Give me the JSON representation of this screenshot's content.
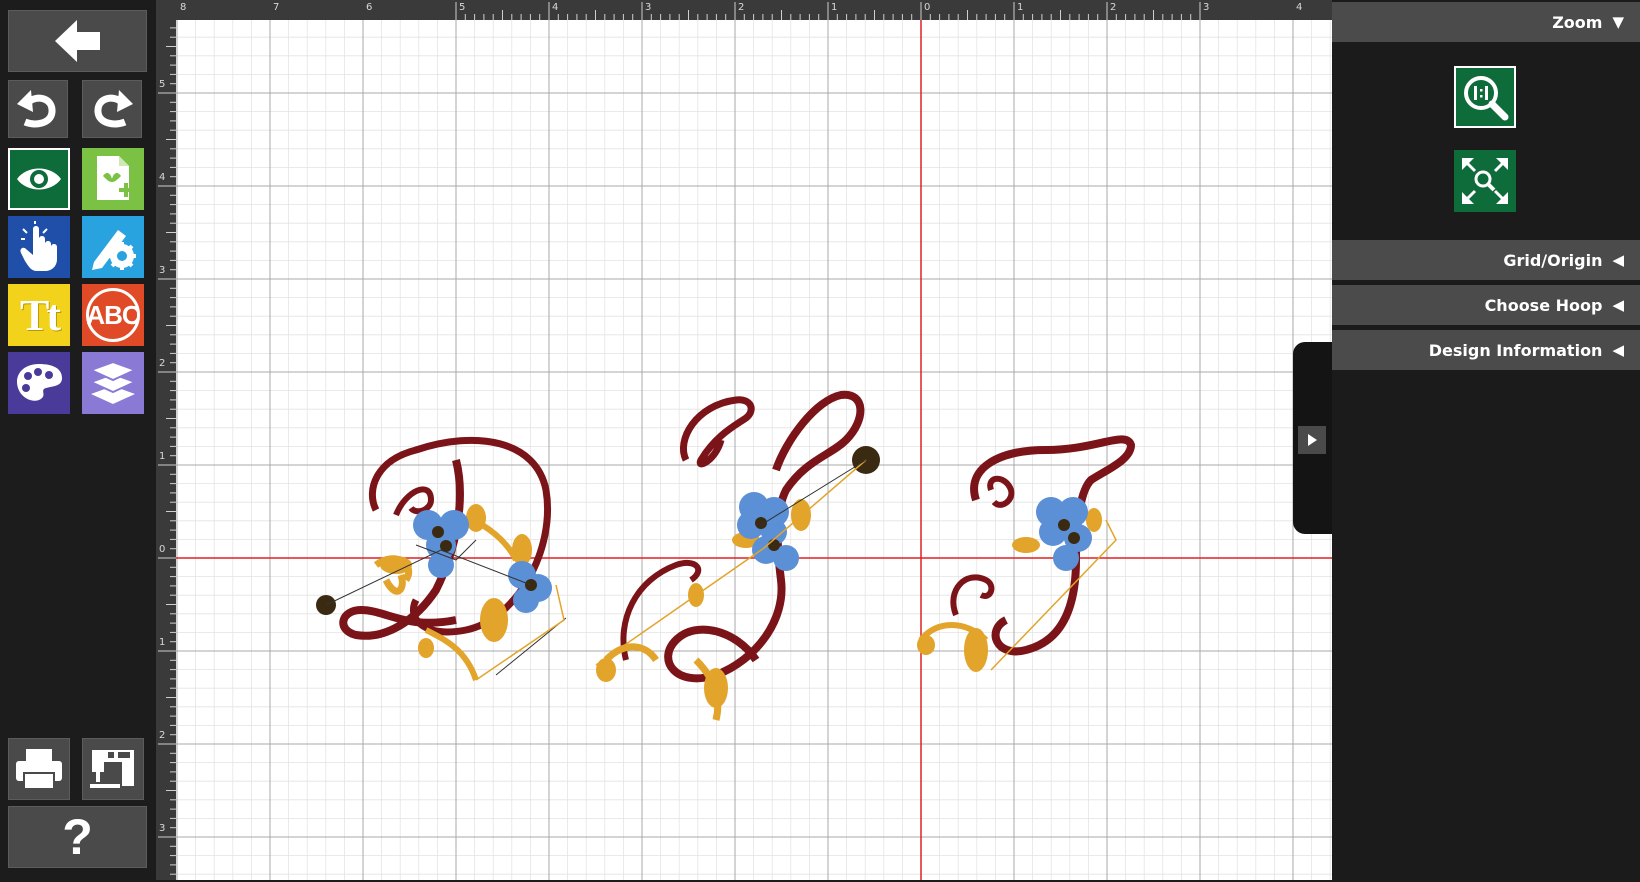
{
  "toolbar": {
    "items": [
      "back",
      "undo",
      "redo",
      "preview",
      "add-design",
      "select",
      "edit",
      "text",
      "monogram",
      "color",
      "layers",
      "print",
      "send-to-machine",
      "help"
    ],
    "text_tool_label": "Tt",
    "monogram_tool_label": "ABC",
    "help_label": "?"
  },
  "ruler": {
    "top_labels": [
      "8",
      "7",
      "6",
      "5",
      "4",
      "3",
      "2",
      "1",
      "0",
      "1",
      "2",
      "3",
      "4"
    ],
    "left_labels": [
      "5",
      "4",
      "3",
      "2",
      "1",
      "0",
      "1",
      "2",
      "3"
    ]
  },
  "design": {
    "letters": [
      "D",
      "S",
      "F"
    ],
    "colors": {
      "letter": "#7b1418",
      "flower": "#5b8fd6",
      "leaf": "#e2a42a",
      "center": "#3a2a12"
    }
  },
  "panel": {
    "zoom_label": "Zoom",
    "zoom_arrow": "▼",
    "sections": [
      {
        "label": "Grid/Origin",
        "arrow": "◀"
      },
      {
        "label": "Choose Hoop",
        "arrow": "◀"
      },
      {
        "label": "Design Information",
        "arrow": "◀"
      }
    ],
    "zoom_buttons": [
      "zoom-actual-size-icon",
      "zoom-fit-icon"
    ]
  },
  "colors": {
    "canvas_bg": "#ffffff",
    "grid_major": "#a8a8a8",
    "grid_minor": "#e4e4e4",
    "axis": "#e02020",
    "zoom_button": "#0e6b3a",
    "panel_header": "#4b4b4b"
  }
}
